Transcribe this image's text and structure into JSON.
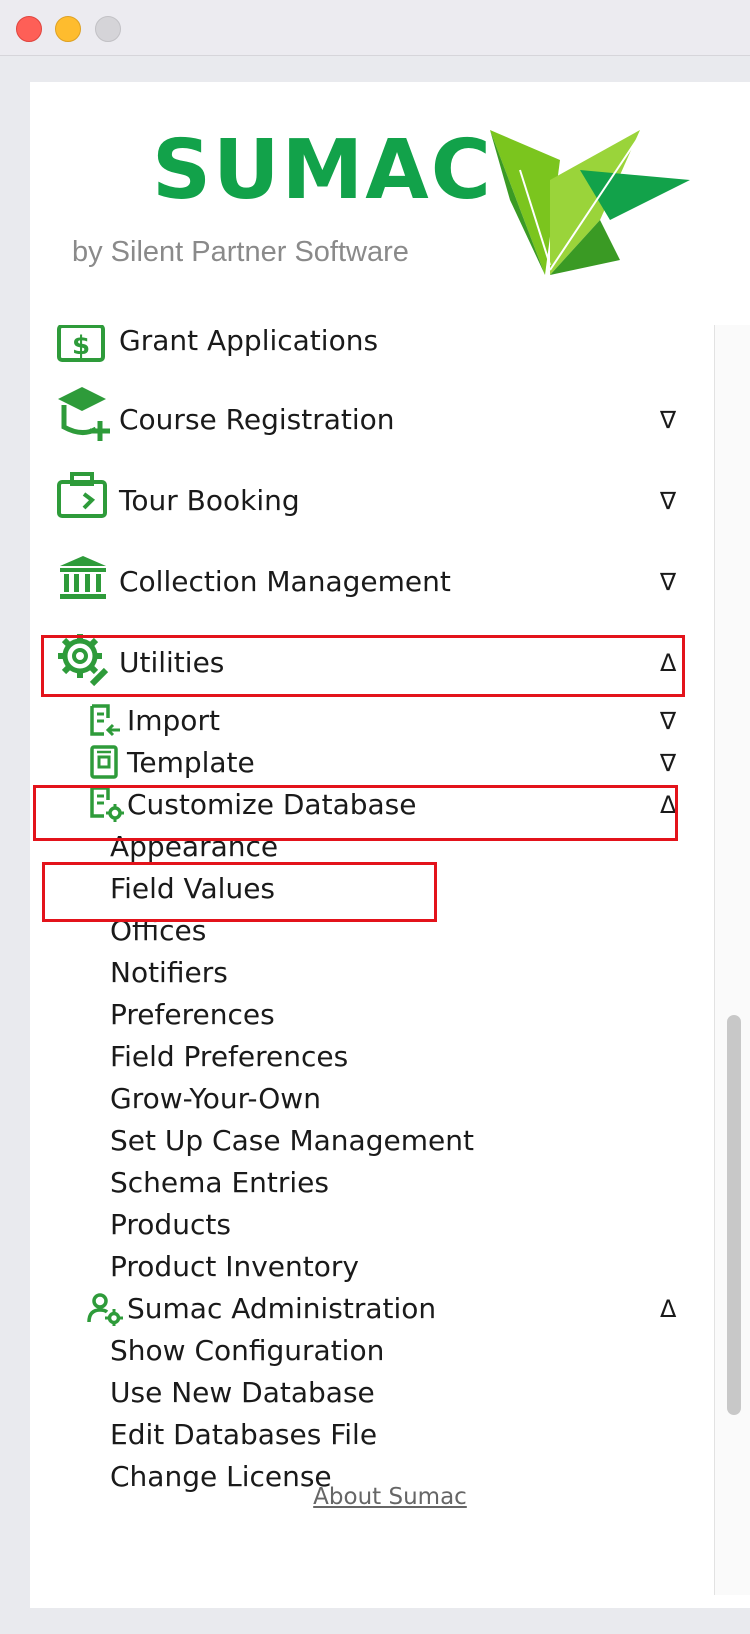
{
  "logo": {
    "wordmark": "SUMAC",
    "tagline": "by Silent Partner Software",
    "brand_color": "#12a24a",
    "leaf_color": "#7bc51e"
  },
  "menu": {
    "items": [
      {
        "label": "Grant Applications",
        "icon": "grant-money-icon",
        "arrow": ""
      },
      {
        "label": "Course Registration",
        "icon": "graduation-cap-icon",
        "arrow": "∇"
      },
      {
        "label": "Tour Booking",
        "icon": "briefcase-icon",
        "arrow": "∇"
      },
      {
        "label": "Collection Management",
        "icon": "museum-icon",
        "arrow": "∇"
      },
      {
        "label": "Utilities",
        "icon": "gear-wrench-icon",
        "arrow": "Δ"
      }
    ],
    "utilities_children": [
      {
        "label": "Import",
        "icon": "import-list-icon",
        "arrow": "∇"
      },
      {
        "label": "Template",
        "icon": "template-icon",
        "arrow": "∇"
      },
      {
        "label": "Customize Database",
        "icon": "database-gear-icon",
        "arrow": "Δ"
      }
    ],
    "customize_children": [
      "Appearance",
      "Field Values",
      "Offices",
      "Notifiers",
      "Preferences",
      "Field Preferences",
      "Grow-Your-Own",
      "Set Up Case Management",
      "Schema Entries",
      "Products",
      "Product Inventory"
    ],
    "admin": {
      "label": "Sumac Administration",
      "icon": "user-gear-icon",
      "arrow": "Δ"
    },
    "admin_children": [
      "Show Configuration",
      "Use New Database",
      "Edit Databases File",
      "Change License"
    ]
  },
  "footer": {
    "about_link": "About Sumac"
  },
  "colors": {
    "icon_green": "#2e9b3a",
    "highlight_red": "#e3131b"
  }
}
